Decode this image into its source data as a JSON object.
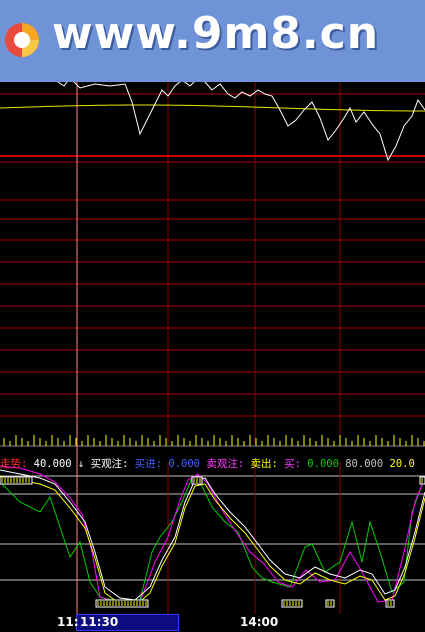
{
  "watermark": {
    "text": "www.9m8.cn",
    "logo": "pie-logo-icon"
  },
  "indicator": {
    "label_trend": "走势:",
    "value_trend": "40.000",
    "label_buy_watch": "买观注:",
    "label_buy": "买进:",
    "value_buy": "0.000",
    "label_sell_watch": "卖观注:",
    "label_sell": "卖出:",
    "label_last": "买:",
    "value_last": "0.000",
    "value_80": "80.000",
    "value_20": "20.0",
    "arrow": "↓"
  },
  "time_axis": {
    "cursor_label": "11:30",
    "cursor_prefix": "11:",
    "mid_label": "14:00"
  },
  "colors": {
    "grid": "#c80000",
    "price": "#ffffff",
    "avg": "#e8e800",
    "k": "#ffffff",
    "d": "#ffff00",
    "j": "#ff00ff",
    "fast": "#00cc00"
  }
}
